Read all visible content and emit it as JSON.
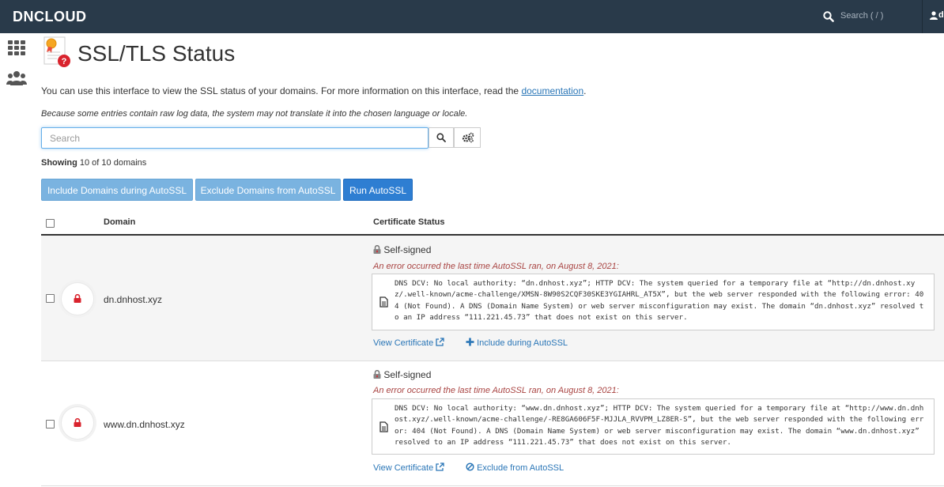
{
  "header": {
    "brand": "DNCLOUD",
    "search_label": "Search ( / )",
    "user_initial": "d"
  },
  "sidebar": {
    "items": [
      {
        "icon": "apps-grid-icon"
      },
      {
        "icon": "users-icon"
      }
    ]
  },
  "page": {
    "title": "SSL/TLS Status",
    "intro_text": "You can use this interface to view the SSL status of your domains. For more information on this interface, read the ",
    "intro_link": "documentation",
    "intro_end": ".",
    "note": "Because some entries contain raw log data, the system may not translate it into the chosen language or locale.",
    "search_placeholder": "Search",
    "showing_label": "Showing",
    "showing_count": "10 of 10 domains"
  },
  "actions": {
    "include_label": "Include Domains during AutoSSL",
    "exclude_label": "Exclude Domains from AutoSSL",
    "run_label": "Run AutoSSL"
  },
  "table": {
    "col_domain": "Domain",
    "col_status": "Certificate Status",
    "rows": [
      {
        "domain": "dn.dnhost.xyz",
        "status": "Self-signed",
        "error_title": "An error occurred the last time AutoSSL ran, on August 8, 2021:",
        "log": "DNS DCV: No local authority: “dn.dnhost.xyz”; HTTP DCV: The system queried for a temporary file at “http://dn.dnhost.xyz/.well-known/acme-challenge/XMSN-8W90S2CQF30SKE3YGIAHRL_AT5X”, but the web server responded with the following error: 404 (Not Found). A DNS (Domain Name System) or web server misconfiguration may exist. The domain “dn.dnhost.xyz” resolved to an IP address “111.221.45.73” that does not exist on this server.",
        "view_cert": "View Certificate",
        "toggle_label": "Include during AutoSSL"
      },
      {
        "domain": "www.dn.dnhost.xyz",
        "status": "Self-signed",
        "error_title": "An error occurred the last time AutoSSL ran, on August 8, 2021:",
        "log": "DNS DCV: No local authority: “www.dn.dnhost.xyz”; HTTP DCV: The system queried for a temporary file at “http://www.dn.dnhost.xyz/.well-known/acme-challenge/-RE8GA606F5F-MJJLA_RVVPM_LZ8ER-S”, but the web server responded with the following error: 404 (Not Found). A DNS (Domain Name System) or web server misconfiguration may exist. The domain “www.dn.dnhost.xyz” resolved to an IP address “111.221.45.73” that does not exist on this server.",
        "view_cert": "View Certificate",
        "toggle_label": "Exclude from AutoSSL"
      }
    ]
  },
  "colors": {
    "topbar": "#293a4a",
    "link": "#2a76b7",
    "error": "#a94442",
    "primary_button": "#2e7ed2",
    "light_button": "#7ab3e0",
    "lock": "#d9232d"
  }
}
